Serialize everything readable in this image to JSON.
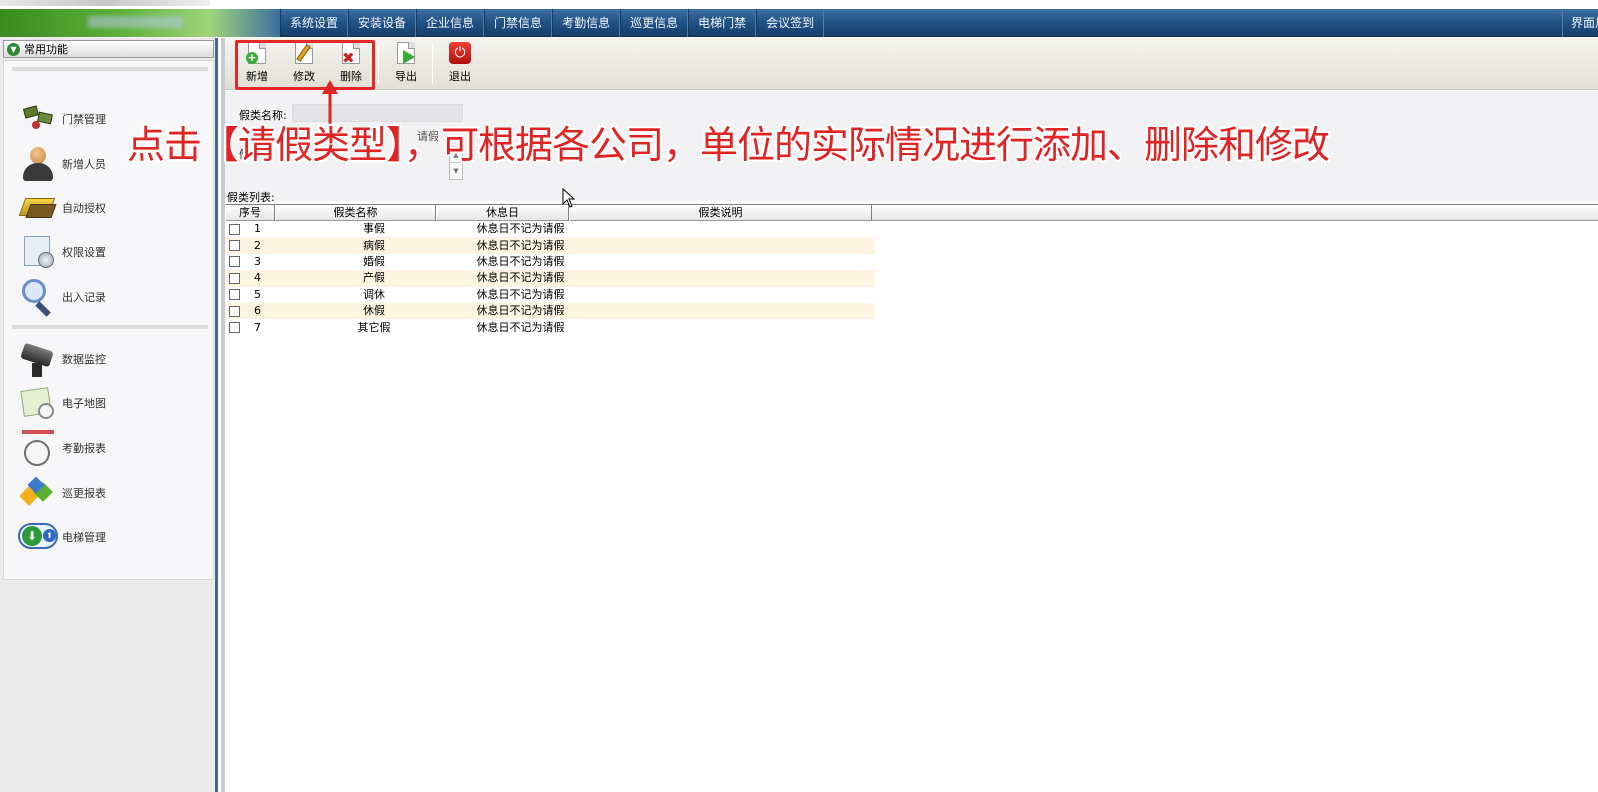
{
  "nav": {
    "items": [
      "系统设置",
      "安装设备",
      "企业信息",
      "门禁信息",
      "考勤信息",
      "巡更信息",
      "电梯门禁",
      "会议签到"
    ],
    "right": "界面风格"
  },
  "sidebar": {
    "header": "常用功能",
    "items": [
      {
        "label": "门禁管理",
        "icon": "door-access-icon"
      },
      {
        "label": "新增人员",
        "icon": "person-icon"
      },
      {
        "label": "自动授权",
        "icon": "card-icon"
      },
      {
        "label": "权限设置",
        "icon": "permission-icon"
      },
      {
        "label": "出入记录",
        "icon": "magnifier-icon"
      },
      {
        "label": "数据监控",
        "icon": "camera-icon"
      },
      {
        "label": "电子地图",
        "icon": "map-icon"
      },
      {
        "label": "考勤报表",
        "icon": "clock-icon"
      },
      {
        "label": "巡更报表",
        "icon": "patrol-icon"
      },
      {
        "label": "电梯管理",
        "icon": "elevator-icon"
      }
    ]
  },
  "toolbar": {
    "new_label": "新增",
    "edit_label": "修改",
    "delete_label": "删除",
    "export_label": "导出",
    "exit_label": "退出"
  },
  "form": {
    "name_label": "假类名称:",
    "name_value": "",
    "ghost_text": "请假",
    "desc_mark": "假"
  },
  "list": {
    "label": "假类列表:",
    "columns": [
      "序号",
      "假类名称",
      "休息日",
      "假类说明"
    ],
    "rows": [
      {
        "idx": "1",
        "name": "事假",
        "rest": "休息日不记为请假",
        "desc": ""
      },
      {
        "idx": "2",
        "name": "病假",
        "rest": "休息日不记为请假",
        "desc": ""
      },
      {
        "idx": "3",
        "name": "婚假",
        "rest": "休息日不记为请假",
        "desc": ""
      },
      {
        "idx": "4",
        "name": "产假",
        "rest": "休息日不记为请假",
        "desc": ""
      },
      {
        "idx": "5",
        "name": "调休",
        "rest": "休息日不记为请假",
        "desc": ""
      },
      {
        "idx": "6",
        "name": "休假",
        "rest": "休息日不记为请假",
        "desc": ""
      },
      {
        "idx": "7",
        "name": "其它假",
        "rest": "休息日不记为请假",
        "desc": ""
      }
    ]
  },
  "annotation": "点击【请假类型】，可根据各公司，单位的实际情况进行添加、删除和修改",
  "colors": {
    "accent": "#e02424",
    "nav": "#1f4f82",
    "row_alt": "#fdf5e2"
  }
}
